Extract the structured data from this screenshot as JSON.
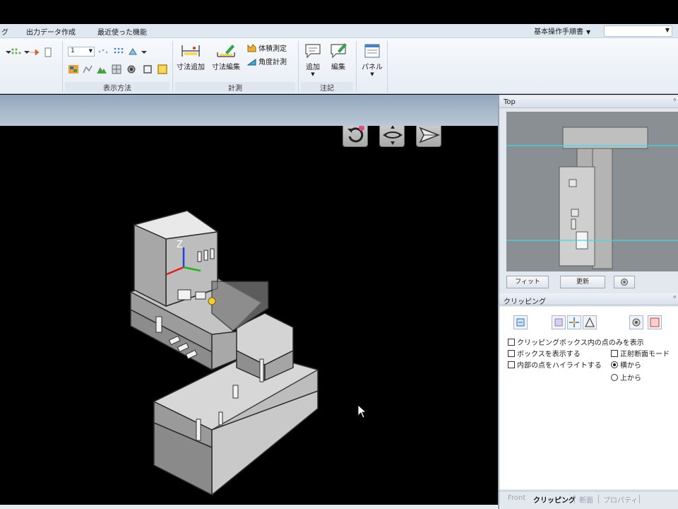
{
  "menubar": {
    "items": [
      "グ",
      "出力データ作成",
      "最近使った機能"
    ],
    "manual_combo": "基本操作手順書"
  },
  "ribbon": {
    "level_combo_value": "1",
    "groups": {
      "display_method": "表示方法",
      "measure": "計測",
      "annotation": "注記"
    },
    "buttons": {
      "dim_add": "寸法追加",
      "dim_edit": "寸法編集",
      "volume": "体積測定",
      "angle": "角度計測",
      "note_add": "追加",
      "note_edit": "編集",
      "panel": "パネル"
    }
  },
  "top_panel": {
    "title": "Top",
    "fit_button": "フィット",
    "refresh_button": "更新"
  },
  "clip_panel": {
    "title": "クリッピング",
    "options": {
      "show_inside_only": "クリッピングボックス内の点のみを表示",
      "show_box": "ボックスを表示する",
      "highlight_inside": "内部の点をハイライトする",
      "ortho_section": "正射断面モード",
      "from_side": "横から",
      "from_top": "上から"
    },
    "state": {
      "show_inside_only": false,
      "show_box": false,
      "highlight_inside": false,
      "ortho_section": false,
      "view_from": "横から"
    }
  },
  "bottom_tabs": [
    "Front",
    "クリッピング",
    "断面",
    "プロパティ"
  ],
  "active_tab": "クリッピング",
  "axis_label": "Z",
  "colors": {
    "ribbon_bg": "#e7edf5",
    "viewport_bg": "#000000",
    "top_view_bg": "#8a8f93",
    "section_line": "#3fd9e6",
    "axis_x": "#e02020",
    "axis_y": "#20b020",
    "axis_z": "#2040e0"
  }
}
